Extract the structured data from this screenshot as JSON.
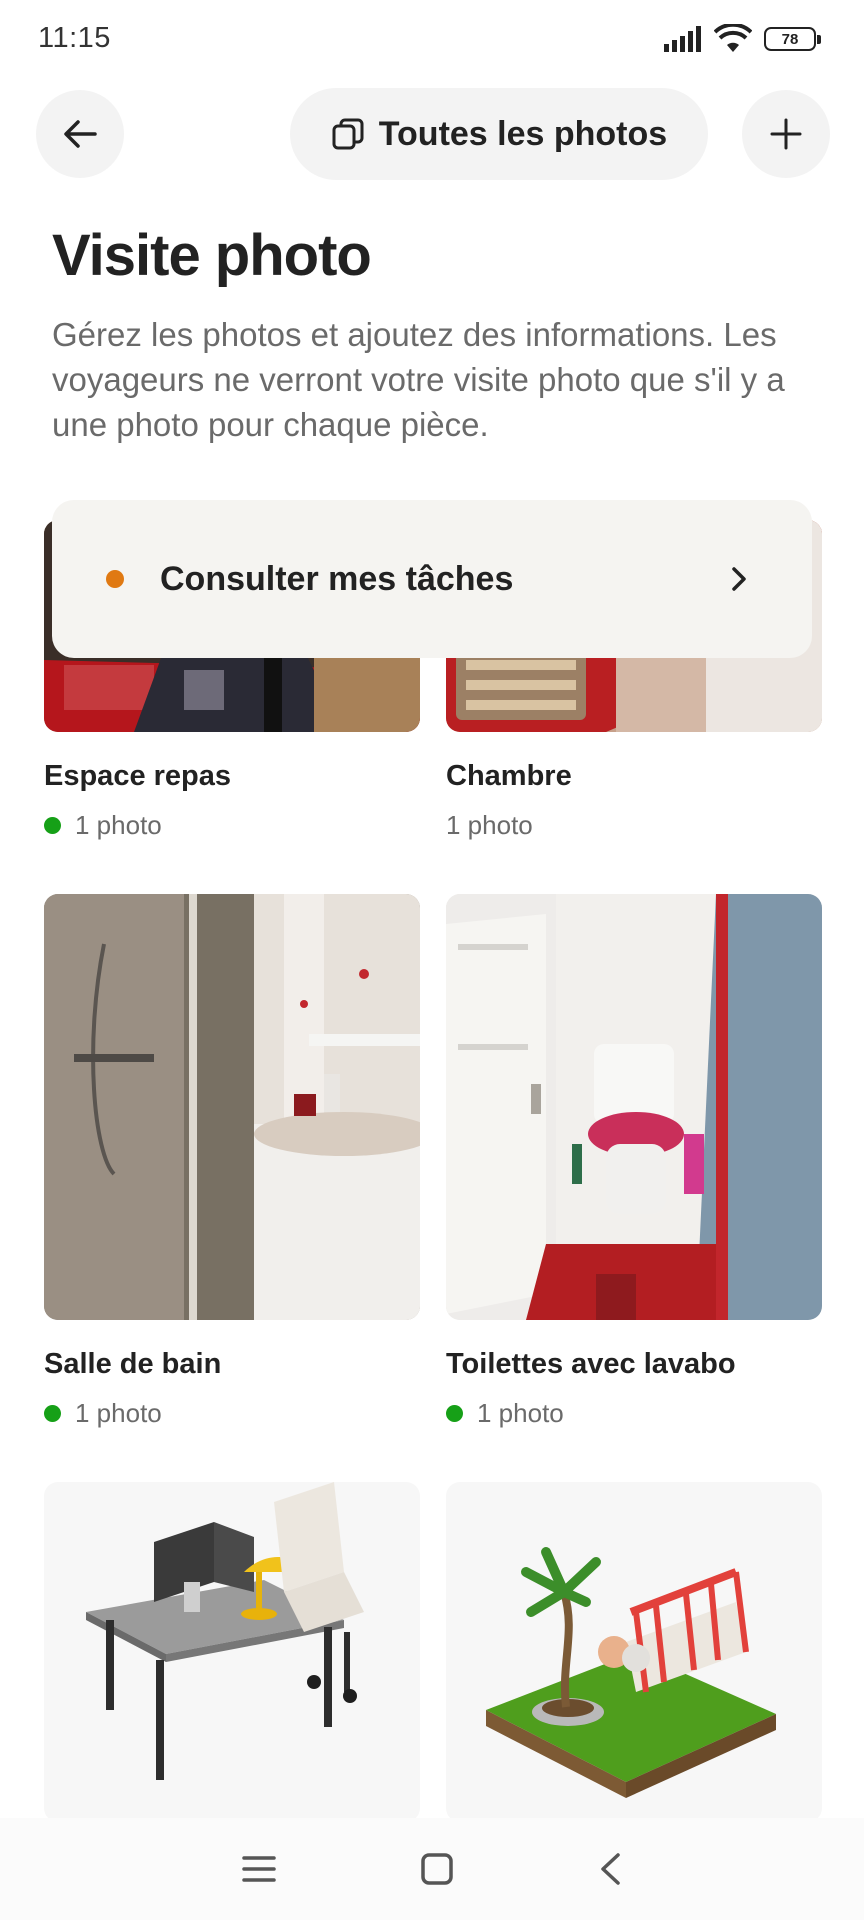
{
  "status_bar": {
    "time": "11:15",
    "battery": "78",
    "icons": [
      "signal-icon",
      "wifi-icon",
      "battery-icon"
    ]
  },
  "nav": {
    "back_icon": "arrow-left-icon",
    "all_photos_label": "Toutes les photos",
    "all_photos_icon": "photo-stack-icon",
    "add_icon": "plus-icon"
  },
  "header": {
    "title": "Visite photo",
    "description": "Gérez les photos et ajoutez des informations. Les voyageurs ne verront votre visite photo que s'il y a une photo pour chaque pièce."
  },
  "tasks": {
    "label": "Consulter mes tâches",
    "dot_color": "#e07912"
  },
  "rooms": [
    {
      "title": "Espace repas",
      "count": "1 photo",
      "complete": true
    },
    {
      "title": "Chambre",
      "count": "1 photo",
      "complete": false
    },
    {
      "title": "Salle de bain",
      "count": "1 photo",
      "complete": true
    },
    {
      "title": "Toilettes avec lavabo",
      "count": "1 photo",
      "complete": true
    },
    {
      "title": "",
      "count": "",
      "complete": false
    },
    {
      "title": "",
      "count": "",
      "complete": false
    }
  ],
  "colors": {
    "status_complete": "#16a017",
    "status_pending": "#e07912",
    "chip_bg": "#f3f3f3"
  },
  "system_nav": {
    "icons": [
      "menu-icon",
      "home-icon",
      "back-icon"
    ]
  }
}
